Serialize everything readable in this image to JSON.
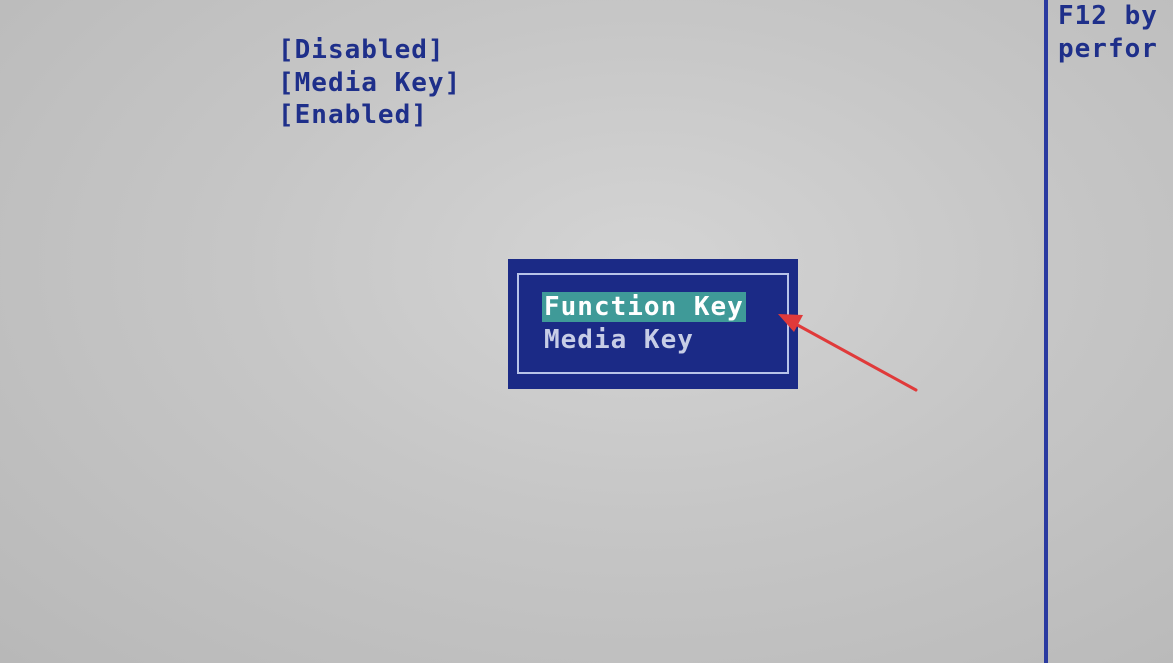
{
  "settings": {
    "values": [
      "[Disabled]",
      "[Media Key]",
      "[Enabled]"
    ]
  },
  "help_panel": {
    "lines": [
      "F12 by",
      "perfor"
    ]
  },
  "popup": {
    "options": [
      "Function Key",
      "Media Key"
    ],
    "selected": "Function Key"
  },
  "annotation": {
    "arrow_icon": "red-arrow-icon",
    "color": "#e03a3a"
  },
  "colors": {
    "bios_text": "#1e2f8a",
    "popup_bg": "#1b2a86",
    "highlight": "#3f9a98"
  }
}
